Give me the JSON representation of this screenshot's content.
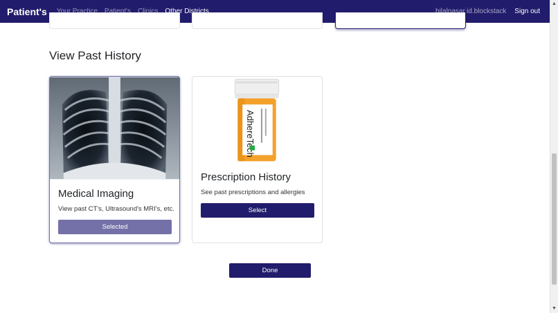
{
  "navbar": {
    "brand": "Patient's",
    "links": [
      {
        "label": "Your Practice"
      },
      {
        "label": "Patient's"
      },
      {
        "label": "Clinics"
      },
      {
        "label": "Other Districts"
      }
    ],
    "user": "bilalnasar.id.blockstack",
    "signout": "Sign out",
    "color": "#211c6b"
  },
  "section_title": "View Past History",
  "cards": [
    {
      "title": "Medical Imaging",
      "text": "View past CT's, Ultrasound's MRI's, etc.",
      "button": "Selected",
      "image_icon": "chest-xray-image",
      "state": "selected"
    },
    {
      "title": "Prescription History",
      "text": "See past prescriptions and allergies",
      "button": "Select",
      "image_icon": "pill-bottle-image",
      "label_text": "AdhereTech",
      "state": "unselected"
    }
  ],
  "done_button": "Done"
}
